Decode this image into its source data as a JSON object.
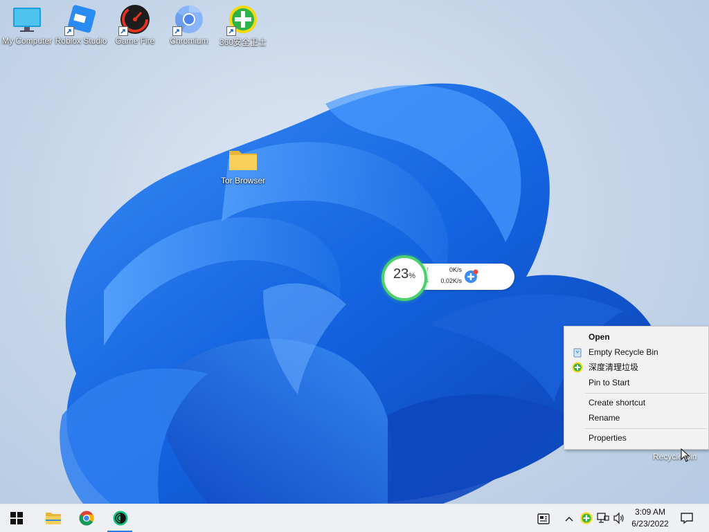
{
  "desktop": {
    "icons": [
      {
        "label": "My Computer",
        "icon": "monitor-icon"
      },
      {
        "label": "Roblox Studio",
        "icon": "roblox-studio-icon"
      },
      {
        "label": "Game Fire",
        "icon": "game-fire-icon"
      },
      {
        "label": "Chromium",
        "icon": "chromium-icon"
      },
      {
        "label": "360安全卫士",
        "icon": "360-security-icon"
      },
      {
        "label": "Tor Browser",
        "icon": "folder-icon"
      },
      {
        "label": "Recycle Bin",
        "icon": "recycle-bin-icon"
      }
    ]
  },
  "widget": {
    "cpu_percent": "23",
    "percent_sign": "%",
    "upload": "0K/s",
    "download": "0.02K/s",
    "ring_color": "#4cd06c"
  },
  "context_menu": {
    "items": [
      {
        "label": "Open",
        "bold": true
      },
      {
        "label": "Empty Recycle Bin",
        "icon": "recycle-bin-small-icon"
      },
      {
        "label": "深度清理垃圾",
        "icon": "360-clean-icon"
      },
      {
        "label": "Pin to Start"
      },
      {
        "label": "Create shortcut"
      },
      {
        "label": "Rename"
      },
      {
        "label": "Properties"
      }
    ]
  },
  "taskbar": {
    "apps": [
      {
        "name": "start",
        "icon": "windows-logo-icon"
      },
      {
        "name": "file-explorer",
        "icon": "folder-icon"
      },
      {
        "name": "chrome",
        "icon": "chrome-icon"
      },
      {
        "name": "tor-browser",
        "icon": "tor-icon",
        "active": true
      }
    ],
    "tray_icons": [
      "news-icon",
      "chevron-up-icon",
      "360-tray-icon",
      "network-icon",
      "volume-icon"
    ],
    "time": "3:09 AM",
    "date": "6/23/2022",
    "accent": "#2b7de0"
  }
}
